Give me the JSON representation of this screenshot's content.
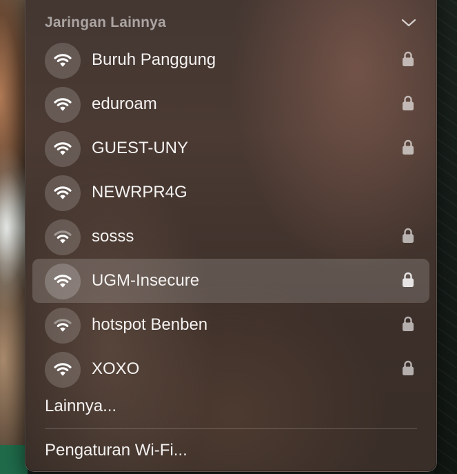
{
  "section": {
    "title": "Jaringan Lainnya",
    "expand_icon": "chevron-down-icon"
  },
  "networks": [
    {
      "name": "Buruh Panggung",
      "secured": true,
      "signal": "full",
      "highlighted": false
    },
    {
      "name": "eduroam",
      "secured": true,
      "signal": "full",
      "highlighted": false
    },
    {
      "name": "GUEST-UNY",
      "secured": true,
      "signal": "full",
      "highlighted": false
    },
    {
      "name": "NEWRPR4G",
      "secured": false,
      "signal": "full",
      "highlighted": false
    },
    {
      "name": "sosss",
      "secured": true,
      "signal": "medium",
      "highlighted": false
    },
    {
      "name": "UGM-Insecure",
      "secured": true,
      "signal": "full",
      "highlighted": true
    },
    {
      "name": "hotspot Benben",
      "secured": true,
      "signal": "medium",
      "highlighted": false
    },
    {
      "name": "XOXO",
      "secured": true,
      "signal": "full",
      "highlighted": false
    }
  ],
  "more_label": "Lainnya...",
  "settings_label": "Pengaturan Wi-Fi...",
  "icons": {
    "wifi": "wifi-icon",
    "lock": "lock-icon"
  },
  "colors": {
    "text": "#f4f2f1",
    "header_text": "#a69d99",
    "highlight": "rgba(255,255,255,0.17)"
  }
}
